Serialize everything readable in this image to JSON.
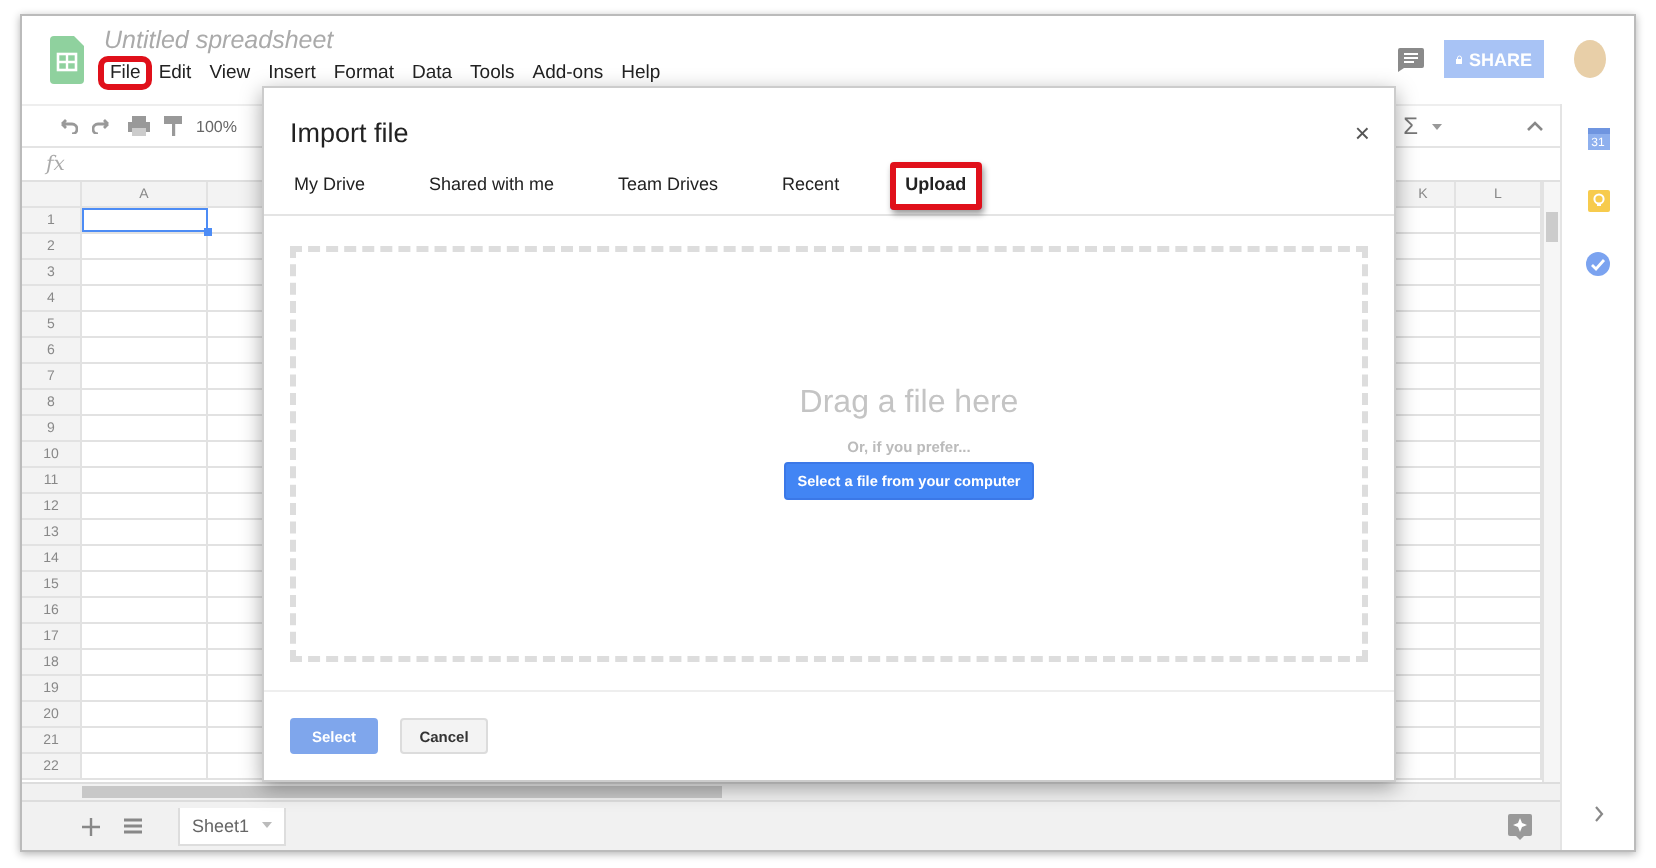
{
  "app": {
    "title": "Untitled spreadsheet"
  },
  "menu": [
    {
      "label": "File",
      "highlighted": true
    },
    {
      "label": "Edit",
      "highlighted": false
    },
    {
      "label": "View",
      "highlighted": false
    },
    {
      "label": "Insert",
      "highlighted": false
    },
    {
      "label": "Format",
      "highlighted": false
    },
    {
      "label": "Data",
      "highlighted": false
    },
    {
      "label": "Tools",
      "highlighted": false
    },
    {
      "label": "Add-ons",
      "highlighted": false
    },
    {
      "label": "Help",
      "highlighted": false
    }
  ],
  "share_button": {
    "label": "SHARE"
  },
  "toolbar": {
    "zoom": "100%",
    "functions": "Σ"
  },
  "formula_bar": {
    "label": "fx"
  },
  "grid": {
    "columns": [
      "A",
      "K",
      "L"
    ],
    "rows": [
      {
        "number": "1",
        "selected": true
      },
      {
        "number": "2",
        "selected": false
      },
      {
        "number": "3",
        "selected": false
      },
      {
        "number": "4",
        "selected": false
      },
      {
        "number": "5",
        "selected": false
      },
      {
        "number": "6",
        "selected": false
      },
      {
        "number": "7",
        "selected": false
      },
      {
        "number": "8",
        "selected": false
      },
      {
        "number": "9",
        "selected": false
      },
      {
        "number": "10",
        "selected": false
      },
      {
        "number": "11",
        "selected": false
      },
      {
        "number": "12",
        "selected": false
      },
      {
        "number": "13",
        "selected": false
      },
      {
        "number": "14",
        "selected": false
      },
      {
        "number": "15",
        "selected": false
      },
      {
        "number": "16",
        "selected": false
      },
      {
        "number": "17",
        "selected": false
      },
      {
        "number": "18",
        "selected": false
      },
      {
        "number": "19",
        "selected": false
      },
      {
        "number": "20",
        "selected": false
      },
      {
        "number": "21",
        "selected": false
      },
      {
        "number": "22",
        "selected": false
      }
    ]
  },
  "sheet_tabs": [
    {
      "label": "Sheet1",
      "selected": true
    }
  ],
  "side_panel": {
    "calendar_day": "31"
  },
  "dialog": {
    "title": "Import file",
    "close": "×",
    "tabs": [
      {
        "label": "My Drive",
        "selected": false,
        "highlighted": false
      },
      {
        "label": "Shared with me",
        "selected": false,
        "highlighted": false
      },
      {
        "label": "Team Drives",
        "selected": false,
        "highlighted": false
      },
      {
        "label": "Recent",
        "selected": false,
        "highlighted": false
      },
      {
        "label": "Upload",
        "selected": true,
        "highlighted": true
      }
    ],
    "drop_title": "Drag a file here",
    "drop_hint": "Or, if you prefer...",
    "browse_button": "Select a file from your computer",
    "buttons": [
      {
        "label": "Select",
        "disabled": true
      },
      {
        "label": "Cancel",
        "disabled": false
      }
    ]
  }
}
